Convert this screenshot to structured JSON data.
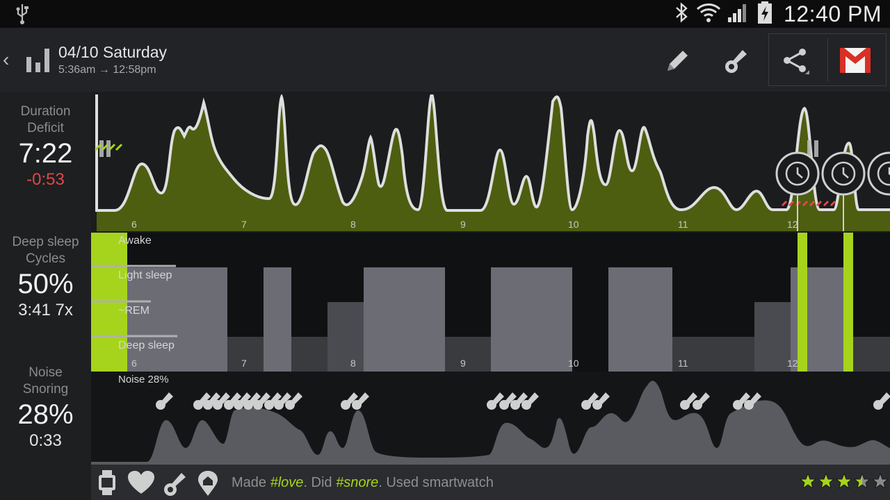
{
  "status_bar": {
    "time": "12:40 PM",
    "icons": [
      "usb-icon",
      "bluetooth-icon",
      "wifi-icon",
      "signal-icon",
      "battery-charging-icon"
    ]
  },
  "header": {
    "title": "04/10 Saturday",
    "subtitle": "5:36am → 12:58pm",
    "actions": [
      "edit-pencil-icon",
      "snore-tag-icon",
      "share-icon",
      "gmail-icon"
    ]
  },
  "stats": {
    "duration": {
      "label1": "Duration",
      "label2": "Deficit",
      "value": "7:22",
      "deficit": "-0:53"
    },
    "deep_sleep": {
      "label1": "Deep sleep",
      "label2": "Cycles",
      "value": "50%",
      "sub": "3:41 7x"
    },
    "noise": {
      "label1": "Noise",
      "label2": "Snoring",
      "value": "28%",
      "sub": "0:33"
    }
  },
  "charts": {
    "hour_ticks": [
      "6",
      "7",
      "8",
      "9",
      "10",
      "11",
      "12"
    ],
    "stages": {
      "awake": "Awake",
      "light": "Light sleep",
      "rem": "~REM",
      "deep": "Deep sleep"
    },
    "noise_label": "Noise 28%"
  },
  "footer": {
    "note_made": "Made ",
    "tag_love": "#love",
    "note_did": ". Did ",
    "tag_snore": "#snore",
    "note_used": ". Used smartwatch",
    "rating": 3.5,
    "rating_max": 5
  },
  "colors": {
    "accent_green": "#a6d41c",
    "movement_fill": "#4d5e10",
    "deficit_red": "#e04848"
  }
}
